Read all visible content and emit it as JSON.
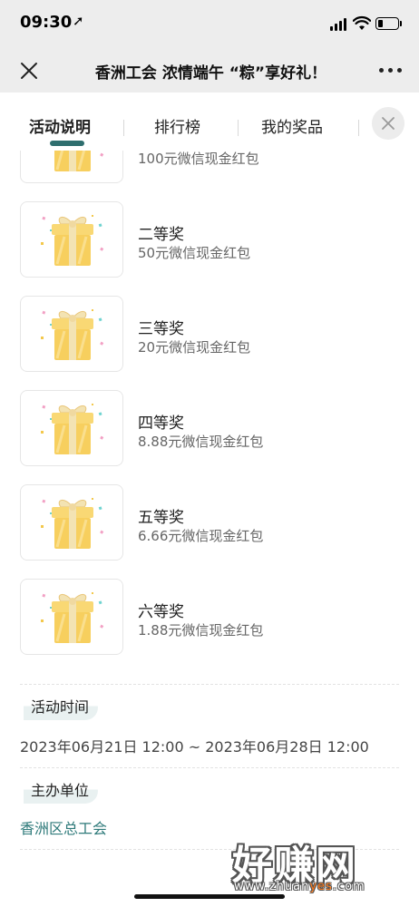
{
  "status_bar": {
    "time": "09:30",
    "location_icon": "location-arrow-icon",
    "battery_level": 0.25
  },
  "nav": {
    "title": "香洲工会 浓情端午 “粽”享好礼！",
    "close_icon": "close-icon",
    "more_icon": "more-icon"
  },
  "tabs": [
    {
      "label": "活动说明",
      "active": true
    },
    {
      "label": "排行榜",
      "active": false
    },
    {
      "label": "我的奖品",
      "active": false
    }
  ],
  "prizes": [
    {
      "name": "",
      "desc": "100元微信现金红包"
    },
    {
      "name": "二等奖",
      "desc": "50元微信现金红包"
    },
    {
      "name": "三等奖",
      "desc": "20元微信现金红包"
    },
    {
      "name": "四等奖",
      "desc": "8.88元微信现金红包"
    },
    {
      "name": "五等奖",
      "desc": "6.66元微信现金红包"
    },
    {
      "name": "六等奖",
      "desc": "1.88元微信现金红包"
    }
  ],
  "activity_time": {
    "label": "活动时间",
    "value": "2023年06月21日 12:00 ~ 2023年06月28日 12:00"
  },
  "organizer": {
    "label": "主办单位",
    "value": "香洲区总工会"
  },
  "watermark": {
    "big": "好赚网",
    "url_prefix": "www.zhuan",
    "url_highlight": "yes",
    "url_suffix": ".com"
  },
  "colors": {
    "accent": "#2e6e6e",
    "link": "#2e7a7a",
    "gift_body": "#f7cf5e",
    "gift_ribbon": "#f3e3b3",
    "highlight": "#ff7a1a"
  }
}
